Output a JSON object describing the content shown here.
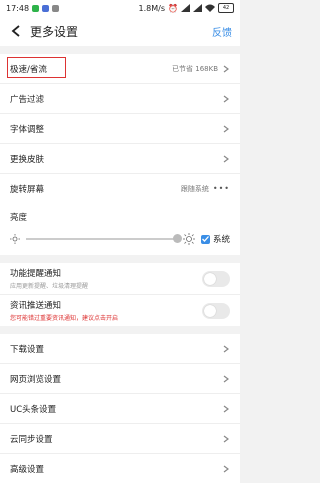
{
  "status": {
    "time": "17:48",
    "net": "1.8M/s",
    "battery": "42"
  },
  "header": {
    "title": "更多设置",
    "feedback": "反馈"
  },
  "group1": {
    "speed": {
      "label": "极速/省流",
      "value": "已节省 168KB"
    },
    "adfilter": {
      "label": "广告过滤"
    },
    "font": {
      "label": "字体调整"
    },
    "skin": {
      "label": "更换皮肤"
    },
    "rotate": {
      "label": "旋转屏幕",
      "value": "跟随系统"
    }
  },
  "brightness": {
    "label": "亮度",
    "system_label": "系统",
    "level": 1.0,
    "system_checked": true
  },
  "notifications": {
    "feature": {
      "label": "功能提醒通知",
      "desc": "应用更新提醒、垃圾清理提醒",
      "on": false
    },
    "info": {
      "label": "资讯推送通知",
      "desc": "您可能错过重要资讯通知，建议点击开启",
      "on": false
    }
  },
  "group2": {
    "download": "下载设置",
    "browse": "网页浏览设置",
    "uc_headline": "UC头条设置",
    "cloud": "云同步设置",
    "advanced": "高级设置"
  },
  "colors": {
    "accent": "#3a8ee6",
    "highlight": "#dd3333"
  }
}
